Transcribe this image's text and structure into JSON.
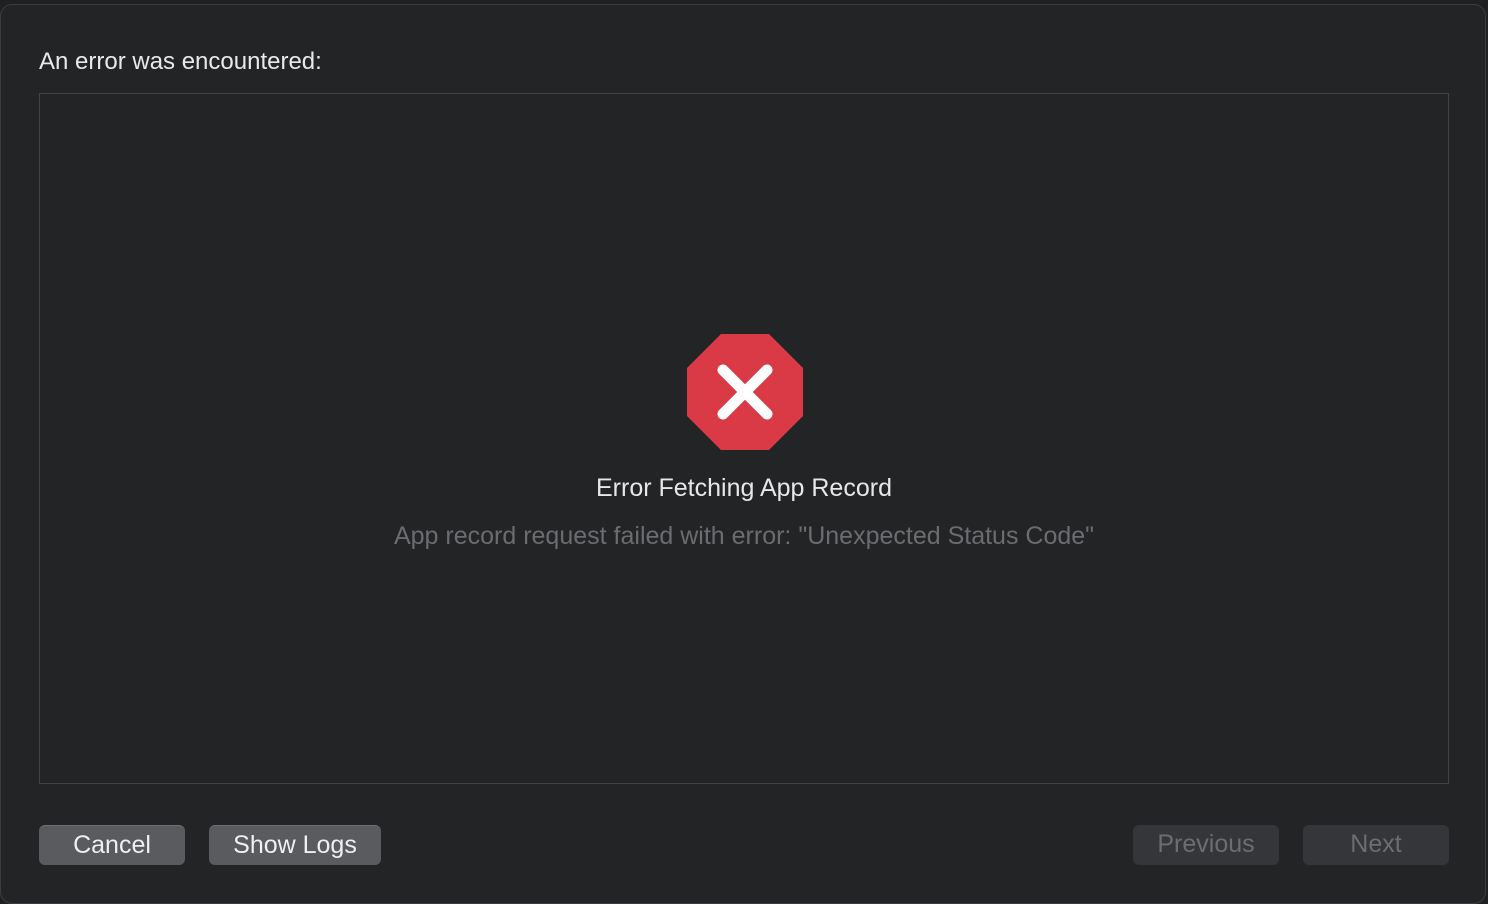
{
  "dialog": {
    "header": "An error was encountered:",
    "error": {
      "icon": "error-octagon-x-icon",
      "icon_color": "#d93a45",
      "title": "Error Fetching App Record",
      "message": "App record request failed with error: \"Unexpected Status Code\""
    }
  },
  "buttons": {
    "cancel": "Cancel",
    "show_logs": "Show Logs",
    "previous": "Previous",
    "next": "Next"
  },
  "states": {
    "previous_enabled": false,
    "next_enabled": false
  }
}
